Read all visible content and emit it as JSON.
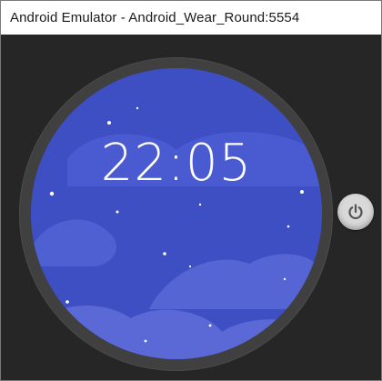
{
  "window": {
    "title": "Android Emulator - Android_Wear_Round:5554"
  },
  "watch": {
    "time": "22:05",
    "charging_icon": "lightning-bolt-icon",
    "power_icon": "power-icon",
    "colors": {
      "screen": "#3e4fc4",
      "clouds": "#5565d3",
      "bezel": "#404040",
      "background": "#262626"
    }
  }
}
